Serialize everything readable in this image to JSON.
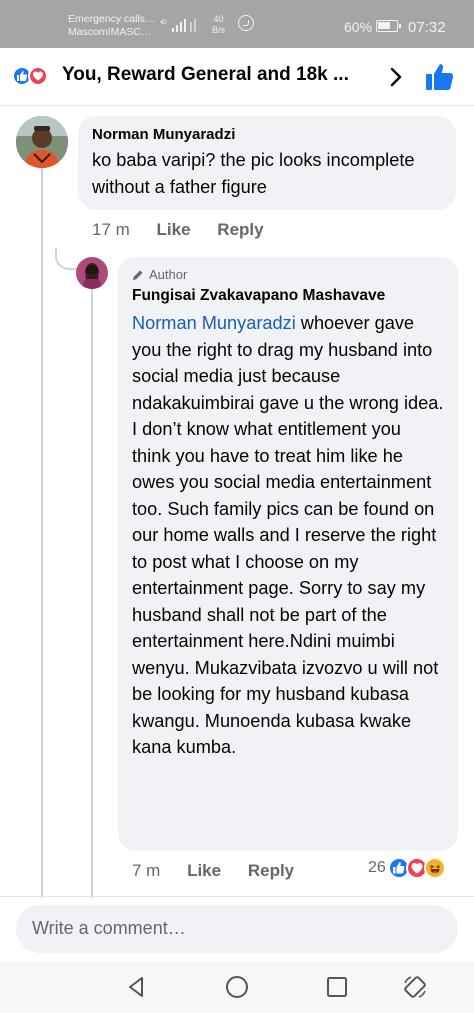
{
  "status_bar": {
    "carrier_line1": "Emergency calls…",
    "carrier_line2": "MascomIMASC…",
    "network": "4G",
    "speed_value": "40",
    "speed_unit": "B/s",
    "battery": "60%",
    "time": "07:32"
  },
  "header": {
    "title": "You, Reward General and 18k ...",
    "reaction_icons": [
      "like-icon",
      "love-icon"
    ]
  },
  "comments": [
    {
      "author": "Norman Munyaradzi",
      "text": "ko baba varipi? the pic looks incomplete without a father figure",
      "time": "17 m",
      "like_label": "Like",
      "reply_label": "Reply"
    }
  ],
  "reply": {
    "badge": "Author",
    "author": "Fungisai Zvakavapano Mashavave",
    "mention": "Norman Munyaradzi",
    "text": " whoever gave you the right to drag my husband into social media just because ndakakuimbirai gave u the wrong idea. I don’t know what entitlement you think you have to treat him like he owes you social media entertainment too. Such family pics can be found on our home walls and I reserve the right to post what I choose on my entertainment page. Sorry to say my husband shall not be part of the entertainment here.Ndini muimbi wenyu. Mukazvibata izvozvo u will not be looking for my husband kubasa kwangu. Munoenda kubasa kwake kana kumba.",
    "time": "7 m",
    "like_label": "Like",
    "reply_label": "Reply",
    "reaction_count": "26",
    "reaction_icons": [
      "like-icon",
      "love-icon",
      "haha-icon"
    ]
  },
  "composer": {
    "placeholder": "Write a comment…"
  },
  "navbar": {
    "buttons": [
      "back-icon",
      "home-icon",
      "recents-icon",
      "rotate-icon"
    ]
  },
  "colors": {
    "facebook_blue": "#1877f2",
    "love_red": "#f33e58",
    "haha_yellow": "#f7b125",
    "bubble_bg": "#f0f2f5",
    "meta_gray": "#65676b"
  }
}
